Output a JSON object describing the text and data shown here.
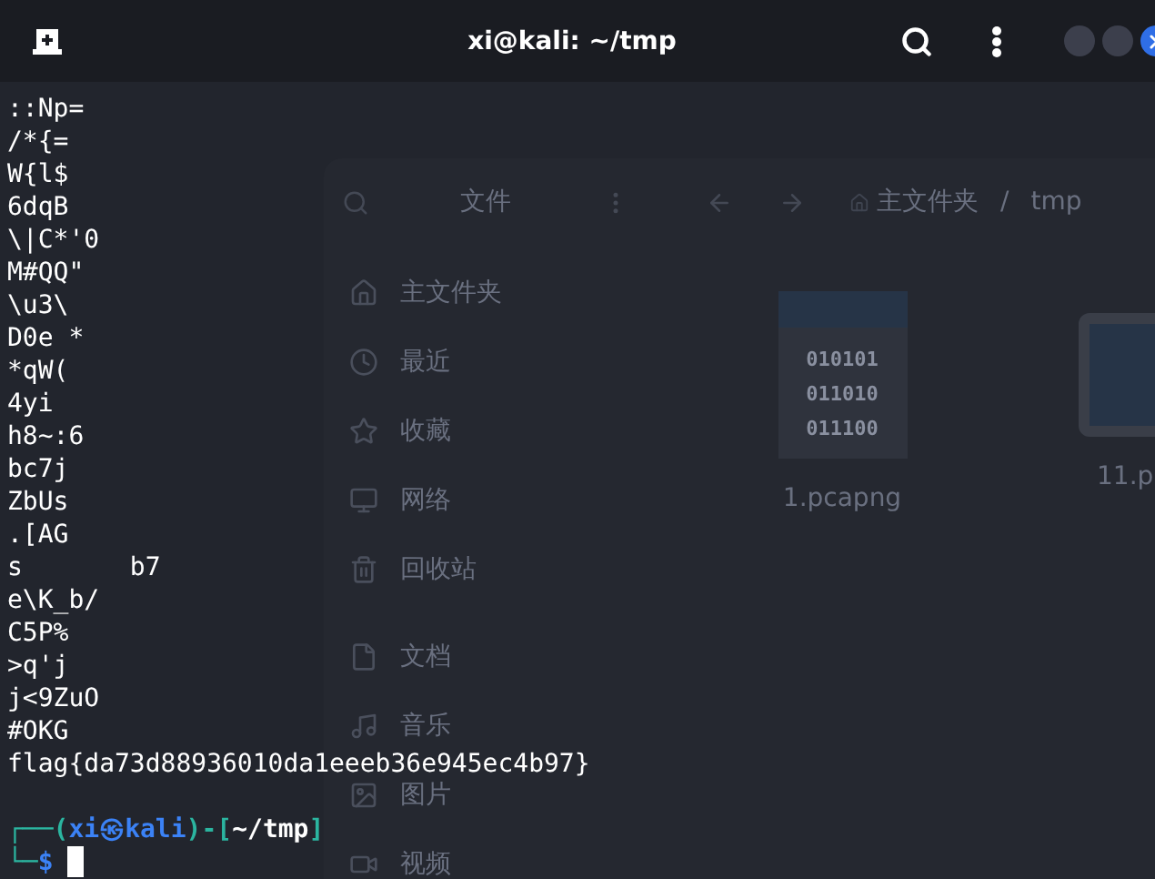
{
  "window": {
    "title": "xi@kali: ~/tmp"
  },
  "terminal": {
    "lines": [
      "::Np=",
      "/*{=",
      "W{l$",
      "6dqB",
      "\\|C*'0",
      "M#QQ\"",
      "\\u3\\",
      "D0e *",
      "*qW(",
      "4yi",
      "h8~:6",
      "bc7j",
      "ZbUs",
      ".[AG",
      "s       b7",
      "e\\K_b/",
      "C5P%",
      ">q'j",
      "j<9ZuO",
      "#OKG",
      "flag{da73d88936010da1eeeb36e945ec4b97}"
    ],
    "prompt": [
      {
        "kind": "frame",
        "text": "┌──("
      },
      {
        "kind": "user",
        "text": "xi㉿kali"
      },
      {
        "kind": "frame",
        "text": ")-["
      },
      {
        "kind": "path",
        "text": "~/tmp"
      },
      {
        "kind": "frame",
        "text": "]"
      }
    ],
    "input": [
      {
        "kind": "frame",
        "text": "└─"
      },
      {
        "kind": "user",
        "text": "$"
      }
    ]
  },
  "file_manager": {
    "title": "文件",
    "breadcrumb": [
      "主文件夹",
      "/",
      "tmp"
    ],
    "sidebar": {
      "sections": [
        [
          {
            "label": "主文件夹"
          },
          {
            "label": "最近"
          },
          {
            "label": "收藏"
          },
          {
            "label": "网络"
          },
          {
            "label": "回收站"
          }
        ],
        [
          {
            "label": "文档"
          },
          {
            "label": "音乐"
          },
          {
            "label": "图片"
          },
          {
            "label": "视频"
          }
        ]
      ]
    },
    "files": [
      {
        "kind": "binary",
        "name": "1.pcapng",
        "icon_text": [
          "010101",
          "011010",
          "011100"
        ]
      },
      {
        "kind": "program",
        "name": "11.p"
      }
    ]
  }
}
